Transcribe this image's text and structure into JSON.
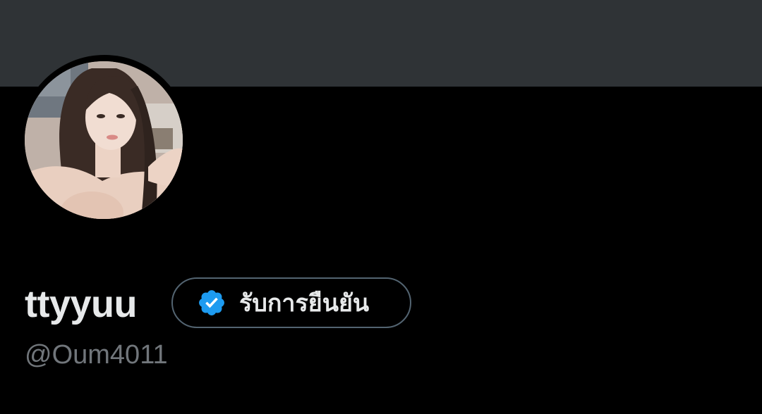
{
  "profile": {
    "display_name": "ttyyuu",
    "handle": "@Oum4011",
    "verify_button_label": "รับการยืนยัน",
    "avatar_icon": "profile-photo",
    "badge_icon": "verified-badge-icon"
  },
  "colors": {
    "background": "#000000",
    "banner": "#2f3336",
    "name_text": "#e7e9ea",
    "handle_text": "#71767b",
    "button_border": "#536471",
    "badge_blue": "#1d9bf0"
  }
}
